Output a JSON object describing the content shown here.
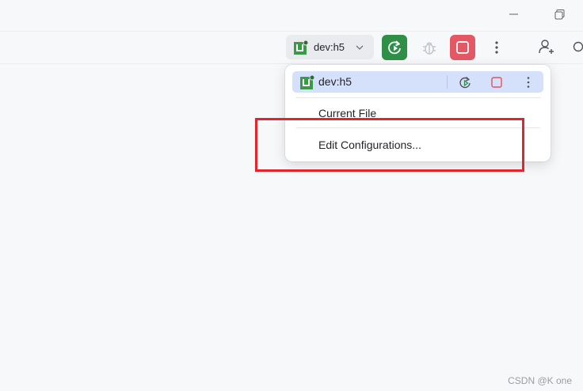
{
  "toolbar": {
    "config_name": "dev:h5"
  },
  "popup": {
    "selected_config": "dev:h5",
    "items": [
      "Current File",
      "Edit Configurations..."
    ]
  },
  "colors": {
    "run": "#2f8f47",
    "stop": "#e45765",
    "selected_row": "#d5e1fb",
    "highlight": "#e0252e"
  },
  "watermark": "CSDN @K  one"
}
